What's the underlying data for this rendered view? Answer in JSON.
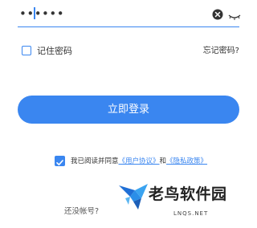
{
  "password": {
    "value": "••••••"
  },
  "remember": {
    "label": "记住密码",
    "checked": false
  },
  "forgot": {
    "label": "忘记密码?"
  },
  "login_button": {
    "label": "立即登录"
  },
  "agreement": {
    "checked": true,
    "prefix": "我已阅读并同意",
    "user_agreement": "《用户协议》",
    "and": "和",
    "privacy_policy": "《隐私政策》"
  },
  "register": {
    "prompt": "还没帐号?"
  },
  "watermark": {
    "title": "老鸟软件园",
    "domain": "LNQS.NET"
  },
  "colors": {
    "accent": "#3a86f0"
  }
}
